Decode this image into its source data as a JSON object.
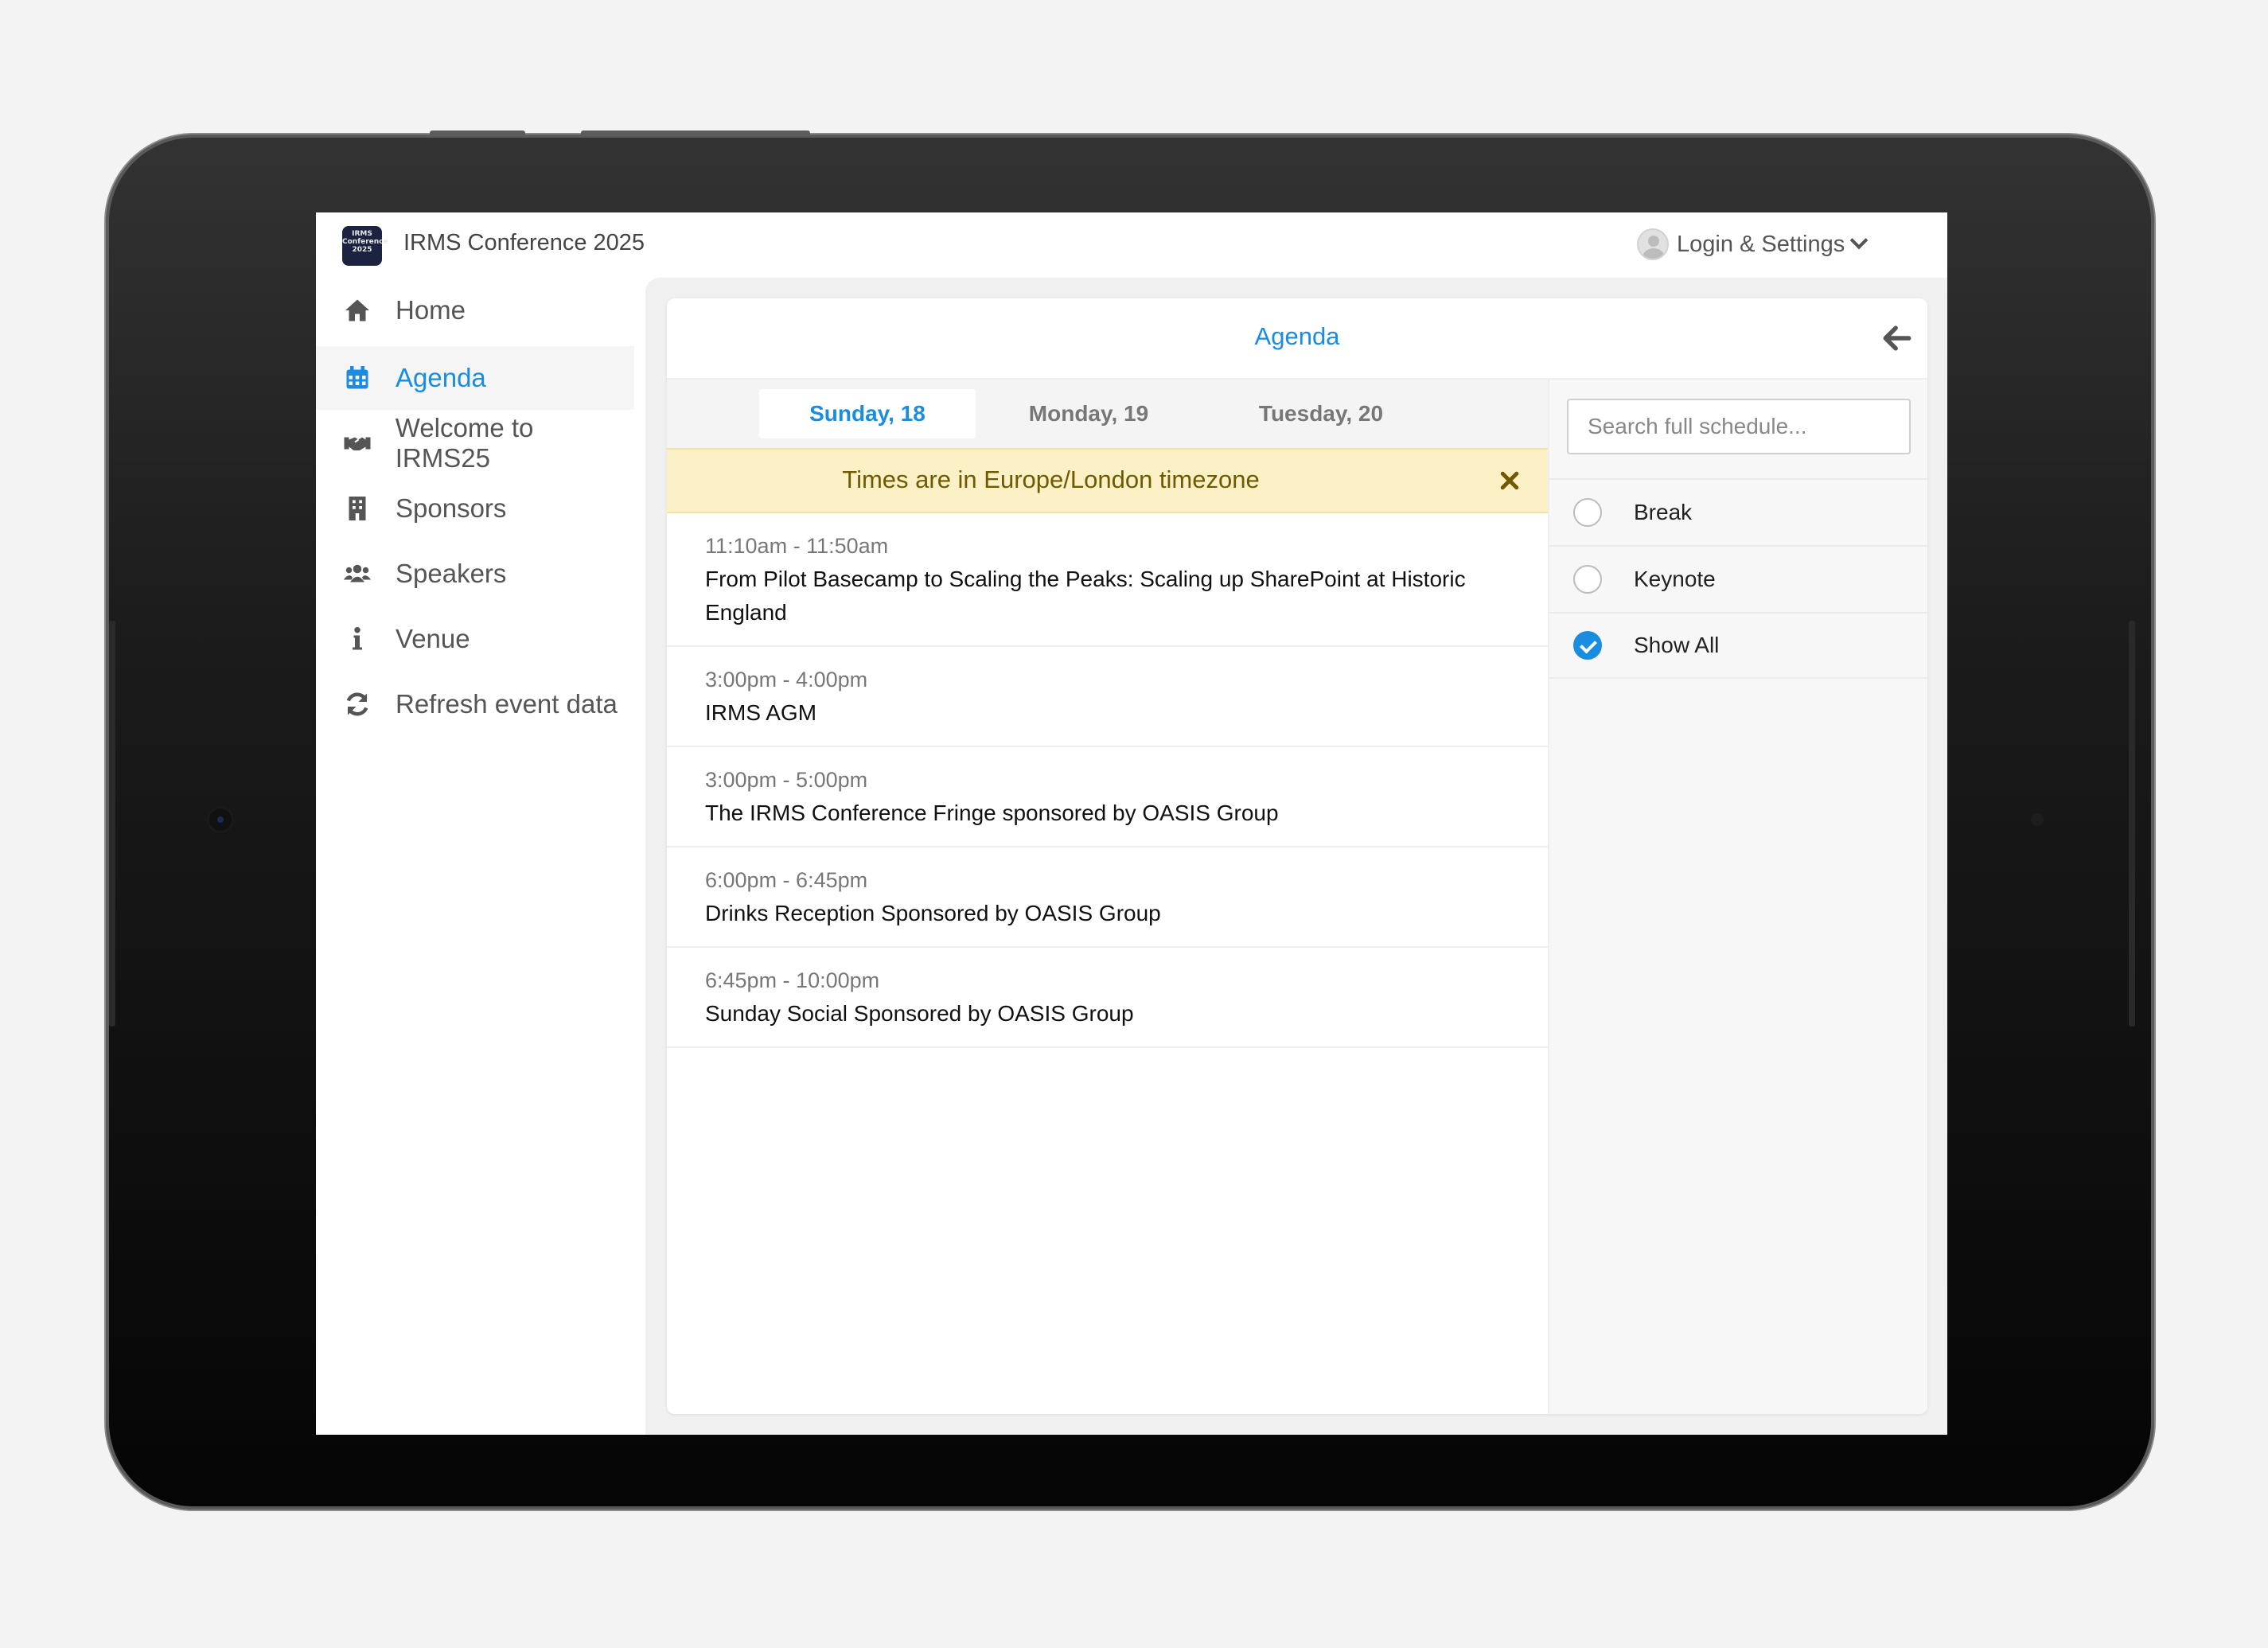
{
  "app": {
    "logo_text": "IRMS Conference 2025",
    "title": "IRMS Conference 2025",
    "settings_label": "Login & Settings"
  },
  "sidebar": {
    "items": [
      {
        "label": "Home",
        "icon": "home-icon"
      },
      {
        "label": "Agenda",
        "icon": "calendar-icon",
        "active": true
      },
      {
        "label": "Welcome to IRMS25",
        "icon": "handshake-icon"
      },
      {
        "label": "Sponsors",
        "icon": "building-icon"
      },
      {
        "label": "Speakers",
        "icon": "users-icon"
      },
      {
        "label": "Venue",
        "icon": "info-icon"
      },
      {
        "label": "Refresh event data",
        "icon": "refresh-icon"
      }
    ]
  },
  "agenda": {
    "title": "Agenda",
    "days": [
      {
        "label": "Sunday, 18",
        "active": true
      },
      {
        "label": "Monday, 19"
      },
      {
        "label": "Tuesday, 20"
      }
    ],
    "timezone_notice": "Times are in Europe/London timezone",
    "sessions": [
      {
        "time": "11:10am - 11:50am",
        "title": "From Pilot Basecamp to Scaling the Peaks: Scaling up SharePoint at Historic England"
      },
      {
        "time": "3:00pm - 4:00pm",
        "title": "IRMS AGM"
      },
      {
        "time": "3:00pm - 5:00pm",
        "title": "The IRMS Conference Fringe sponsored by OASIS Group"
      },
      {
        "time": "6:00pm - 6:45pm",
        "title": "Drinks Reception Sponsored by OASIS Group"
      },
      {
        "time": "6:45pm - 10:00pm",
        "title": "Sunday Social Sponsored by OASIS Group"
      }
    ]
  },
  "filters": {
    "search_placeholder": "Search full schedule...",
    "options": [
      {
        "label": "Break",
        "checked": false
      },
      {
        "label": "Keynote",
        "checked": false
      },
      {
        "label": "Show All",
        "checked": true
      }
    ]
  },
  "colors": {
    "accent": "#1a8de0",
    "banner_bg": "#fcf1c6",
    "banner_text": "#6e5a00"
  }
}
